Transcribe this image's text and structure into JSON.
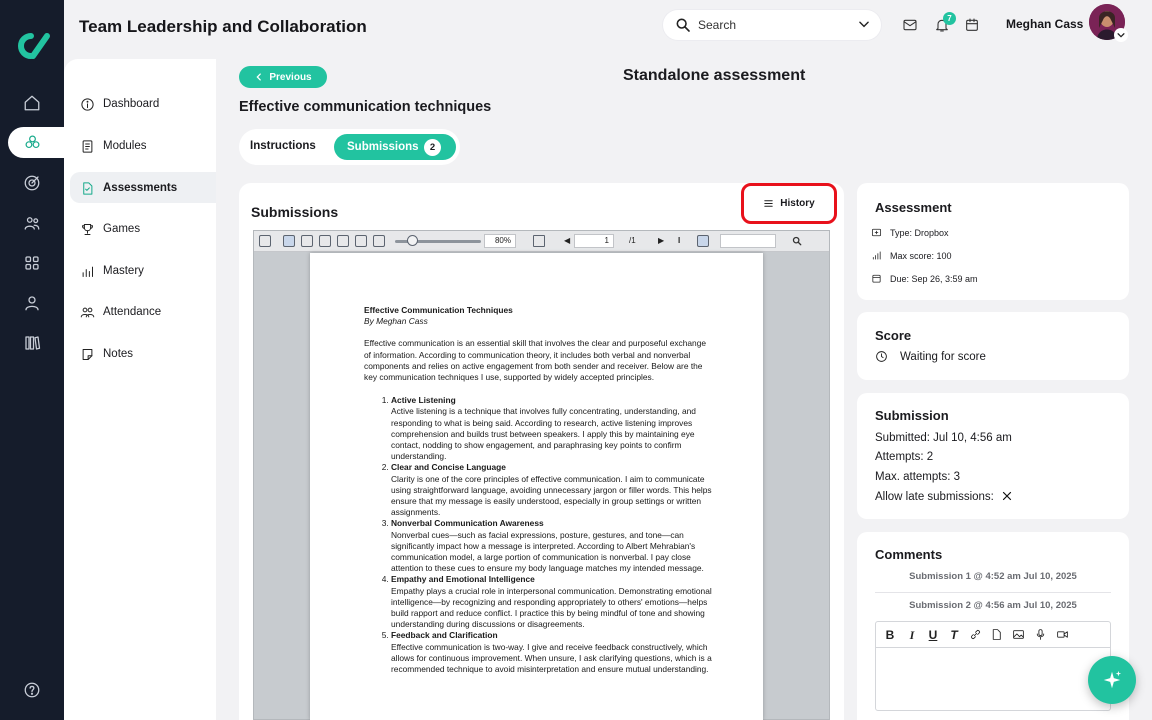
{
  "app": {
    "title": "Team Leadership and Collaboration"
  },
  "header": {
    "search_placeholder": "Search",
    "notifications_count": "7",
    "user_name": "Meghan Cass"
  },
  "course_nav": {
    "items": [
      {
        "label": "Dashboard",
        "icon": "info-circle-icon"
      },
      {
        "label": "Modules",
        "icon": "book-icon"
      },
      {
        "label": "Assessments",
        "icon": "document-icon"
      },
      {
        "label": "Games",
        "icon": "trophy-icon"
      },
      {
        "label": "Mastery",
        "icon": "bar-chart-icon"
      },
      {
        "label": "Attendance",
        "icon": "people-icon"
      },
      {
        "label": "Notes",
        "icon": "note-icon"
      }
    ],
    "active": "Assessments"
  },
  "main": {
    "previous_label": "Previous",
    "page_title": "Standalone assessment",
    "assessment_title": "Effective communication techniques",
    "tabs": {
      "instructions": "Instructions",
      "submissions": "Submissions",
      "submissions_count": "2"
    },
    "submissions_title": "Submissions",
    "history_label": "History"
  },
  "viewer": {
    "zoom": "80%",
    "page_current": "1",
    "page_total": "/1"
  },
  "document": {
    "title": "Effective Communication Techniques",
    "byline": "By Meghan Cass",
    "intro": "Effective communication is an essential skill that involves the clear and purposeful exchange of information. According to communication theory, it includes both verbal and nonverbal components and relies on active engagement from both sender and receiver. Below are the key communication techniques I use, supported by widely accepted principles.",
    "items": [
      {
        "heading": "Active Listening",
        "body": "Active listening is a technique that involves fully concentrating, understanding, and responding to what is being said. According to research, active listening improves comprehension and builds trust between speakers. I apply this by maintaining eye contact, nodding to show engagement, and paraphrasing key points to confirm understanding."
      },
      {
        "heading": "Clear and Concise Language",
        "body": "Clarity is one of the core principles of effective communication. I aim to communicate using straightforward language, avoiding unnecessary jargon or filler words. This helps ensure that my message is easily understood, especially in group settings or written assignments."
      },
      {
        "heading": "Nonverbal Communication Awareness",
        "body": "Nonverbal cues—such as facial expressions, posture, gestures, and tone—can significantly impact how a message is interpreted. According to Albert Mehrabian's communication model, a large portion of communication is nonverbal. I pay close attention to these cues to ensure my body language matches my intended message."
      },
      {
        "heading": "Empathy and Emotional Intelligence",
        "body": "Empathy plays a crucial role in interpersonal communication. Demonstrating emotional intelligence—by recognizing and responding appropriately to others' emotions—helps build rapport and reduce conflict. I practice this by being mindful of tone and showing understanding during discussions or disagreements."
      },
      {
        "heading": "Feedback and Clarification",
        "body": "Effective communication is two-way. I give and receive feedback constructively, which allows for continuous improvement. When unsure, I ask clarifying questions, which is a recommended technique to avoid misinterpretation and ensure mutual understanding."
      }
    ]
  },
  "assessment_card": {
    "title": "Assessment",
    "type": "Type: Dropbox",
    "max_score": "Max score: 100",
    "due": "Due: Sep 26, 3:59 am"
  },
  "score_card": {
    "title": "Score",
    "status": "Waiting for score"
  },
  "submission_card": {
    "title": "Submission",
    "submitted": "Submitted: Jul 10, 4:56 am",
    "attempts": "Attempts: 2",
    "max_attempts": "Max. attempts: 3",
    "late": "Allow late submissions:"
  },
  "comments_card": {
    "title": "Comments",
    "submission_1": "Submission 1 @ 4:52 am Jul 10, 2025",
    "submission_2": "Submission 2 @ 4:56 am Jul 10, 2025"
  },
  "colors": {
    "accent": "#22c3a0",
    "rail": "#151c2b",
    "highlight": "#e8111b"
  }
}
